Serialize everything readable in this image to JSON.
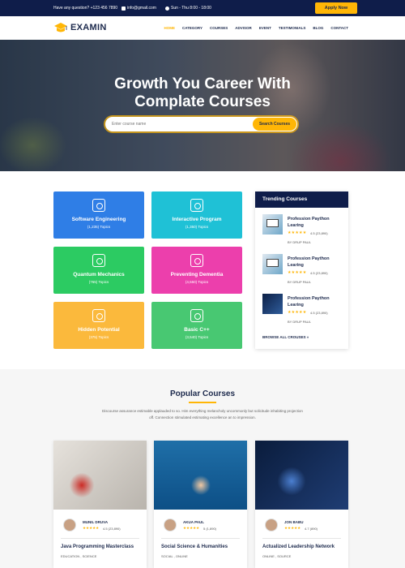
{
  "topbar": {
    "question": "Have any question? +123 456 7890",
    "email": "info@gmail.com",
    "hours": "Sun - Thu  8:00 - 18:00",
    "apply_label": "Apply Now"
  },
  "header": {
    "logo_text": "EXAMIN",
    "nav": [
      "HOME",
      "CATEGORY",
      "COURSES",
      "ADVISOR",
      "EVENT",
      "TESTIMONIALS",
      "BLOG",
      "CONTACT"
    ],
    "active_nav": "HOME"
  },
  "hero": {
    "title_line1": "Growth You Career With",
    "title_line2": "Complate Courses",
    "search_placeholder": "Enter course name",
    "search_button": "Search Courses"
  },
  "categories": [
    {
      "title": "Software Engineering",
      "topics": "(1,235) Topics",
      "color": "#2f7ee6",
      "icon": "computer-gear-icon"
    },
    {
      "title": "Interactive Program",
      "topics": "(1,350) Topics",
      "color": "#1fc1d6",
      "icon": "network-icon"
    },
    {
      "title": "Quantum Mechanics",
      "topics": "(765) Topics",
      "color": "#2ccb62",
      "icon": "atom-gear-icon"
    },
    {
      "title": "Preventing Dementia",
      "topics": "(4,550) Topics",
      "color": "#ec3fac",
      "icon": "brain-icon"
    },
    {
      "title": "Hidden Potential",
      "topics": "(375) Topics",
      "color": "#fbb93c",
      "icon": "idea-head-icon"
    },
    {
      "title": "Basic C++",
      "topics": "(3,540) Topics",
      "color": "#48c872",
      "icon": "code-monitor-icon"
    }
  ],
  "trending": {
    "heading": "Trending Courses",
    "items": [
      {
        "title": "Profession Paython Learing",
        "stars": "★★★★★",
        "rating": "4.5 (23,890)",
        "author": "BY DRUP PAUL"
      },
      {
        "title": "Profession Paython Learing",
        "stars": "★★★★★",
        "rating": "4.5 (23,890)",
        "author": "BY DRUP PAUL"
      },
      {
        "title": "Profession Paython Learing",
        "stars": "★★★★★",
        "rating": "4.5 (23,890)",
        "author": "BY DRUP PAUL"
      }
    ],
    "browse_label": "BROWSE ALL CROUSES »"
  },
  "popular": {
    "title": "Popular Courses",
    "description": "Discourse assurance estimable applauded to so. Him everything melancholy uncommonly but solicitude inhabiting projection off. Connection stimulated estimating excellence an to impression.",
    "courses": [
      {
        "instructor": "MUNIL DRUVA",
        "stars": "★★★★★",
        "rating": "4.5 (23,890)",
        "title": "Java Programming Masterclass",
        "tags": "EDUCATION , SCIENCE"
      },
      {
        "instructor": "AKUA PAUL",
        "stars": "★★★★★",
        "rating": "5 (1,890)",
        "title": "Social Science & Humanities",
        "tags": "SOCIAL , ONLINE"
      },
      {
        "instructor": "JON BABU",
        "stars": "★★★★★",
        "rating": "4.7 (890)",
        "title": "Actualized Leadership Network",
        "tags": "ONLINE , SOURCE"
      }
    ]
  }
}
